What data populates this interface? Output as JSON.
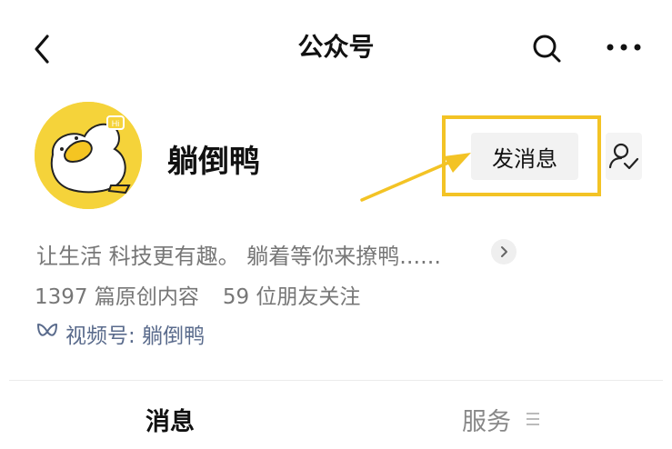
{
  "header": {
    "title": "公众号",
    "back_icon": "chevron-left-icon",
    "search_icon": "search-icon",
    "more_icon": "more-horizontal-icon"
  },
  "profile": {
    "name": "躺倒鸭",
    "avatar_badge": "Hi",
    "avatar_bg": "#f5d33a",
    "send_message_label": "发消息",
    "follow_icon": "user-check-icon",
    "highlight_color": "#f3c325"
  },
  "info": {
    "description": "让生活 科技更有趣。 躺着等你来撩鸭......",
    "original_count": "1397 篇原创内容",
    "friends_following": "59 位朋友关注",
    "channel_label": "视频号:",
    "channel_name": "躺倒鸭",
    "link_color": "#5a6b8c"
  },
  "tabs": {
    "messages": "消息",
    "services": "服务"
  }
}
